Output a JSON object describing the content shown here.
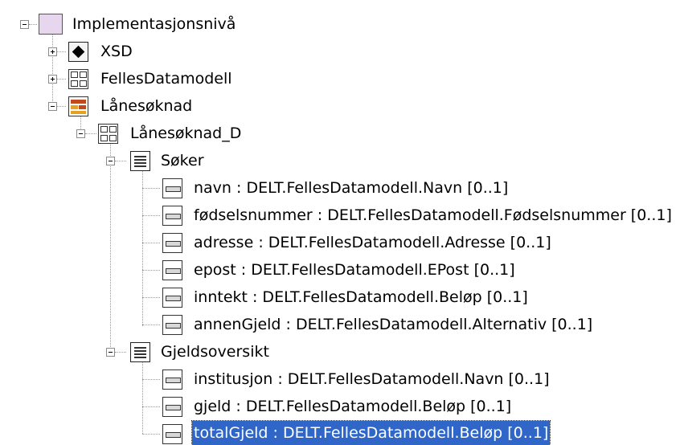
{
  "tree": {
    "root": {
      "label": "Implementasjonsnivå",
      "icon": "package-icon"
    },
    "xsd": {
      "label": "XSD",
      "icon": "xsd-diamond-icon"
    },
    "fellesdatamodell": {
      "label": "FellesDatamodell",
      "icon": "model-icon"
    },
    "lanesoknad": {
      "label": "Lånesøknad",
      "icon": "form-icon"
    },
    "lanesoknad_d": {
      "label": "Lånesøknad_D",
      "icon": "model-icon"
    },
    "soker": {
      "label": "Søker",
      "icon": "class-icon",
      "attributes": [
        {
          "label": "navn : DELT.FellesDatamodell.Navn [0..1]"
        },
        {
          "label": "fødselsnummer : DELT.FellesDatamodell.Fødselsnummer [0..1]"
        },
        {
          "label": "adresse : DELT.FellesDatamodell.Adresse [0..1]"
        },
        {
          "label": "epost : DELT.FellesDatamodell.EPost [0..1]"
        },
        {
          "label": "inntekt : DELT.FellesDatamodell.Beløp [0..1]"
        },
        {
          "label": "annenGjeld : DELT.FellesDatamodell.Alternativ [0..1]"
        }
      ]
    },
    "gjeldsoversikt": {
      "label": "Gjeldsoversikt",
      "icon": "class-icon",
      "attributes": [
        {
          "label": "institusjon : DELT.FellesDatamodell.Navn [0..1]"
        },
        {
          "label": "gjeld : DELT.FellesDatamodell.Beløp [0..1]"
        },
        {
          "label": "totalGjeld : DELT.FellesDatamodell.Beløp [0..1]",
          "selected": true
        }
      ]
    }
  },
  "colors": {
    "selection": "#2f66c8",
    "package": "#e8d6ef",
    "form_red": "#c04a1c",
    "form_orange": "#e8a020"
  }
}
